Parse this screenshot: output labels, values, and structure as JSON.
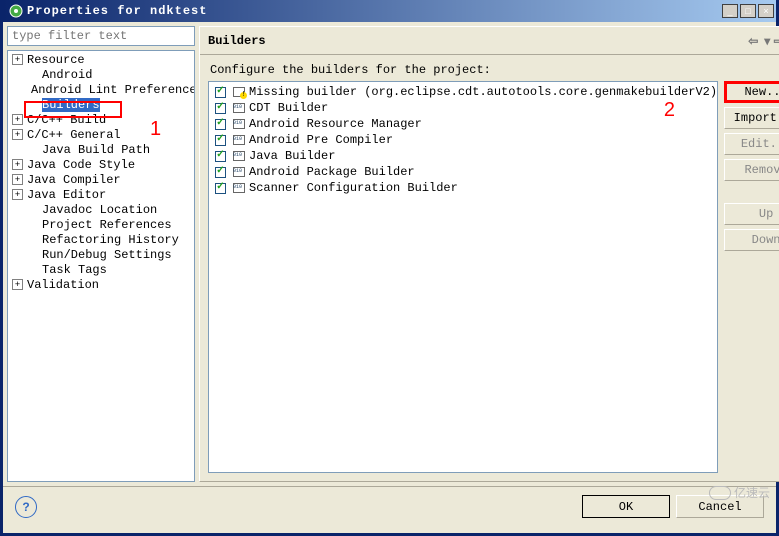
{
  "window": {
    "title": "Properties for ndktest"
  },
  "filter": {
    "placeholder": "type filter text"
  },
  "tree": [
    {
      "label": "Resource",
      "expand": "+",
      "depth": 1
    },
    {
      "label": "Android",
      "expand": "",
      "depth": 2
    },
    {
      "label": "Android Lint Preferences",
      "expand": "",
      "depth": 2
    },
    {
      "label": "Builders",
      "expand": "",
      "depth": 2,
      "selected": true
    },
    {
      "label": "C/C++ Build",
      "expand": "+",
      "depth": 1
    },
    {
      "label": "C/C++ General",
      "expand": "+",
      "depth": 1
    },
    {
      "label": "Java Build Path",
      "expand": "",
      "depth": 2
    },
    {
      "label": "Java Code Style",
      "expand": "+",
      "depth": 1
    },
    {
      "label": "Java Compiler",
      "expand": "+",
      "depth": 1
    },
    {
      "label": "Java Editor",
      "expand": "+",
      "depth": 1
    },
    {
      "label": "Javadoc Location",
      "expand": "",
      "depth": 2
    },
    {
      "label": "Project References",
      "expand": "",
      "depth": 2
    },
    {
      "label": "Refactoring History",
      "expand": "",
      "depth": 2
    },
    {
      "label": "Run/Debug Settings",
      "expand": "",
      "depth": 2
    },
    {
      "label": "Task Tags",
      "expand": "",
      "depth": 2
    },
    {
      "label": "Validation",
      "expand": "+",
      "depth": 1
    }
  ],
  "panel": {
    "title": "Builders",
    "subtitle": "Configure the builders for the project:",
    "items": [
      {
        "label": "Missing builder (org.eclipse.cdt.autotools.core.genmakebuilderV2)",
        "icon": "warn"
      },
      {
        "label": "CDT Builder",
        "icon": "bin"
      },
      {
        "label": "Android Resource Manager",
        "icon": "bin"
      },
      {
        "label": "Android Pre Compiler",
        "icon": "bin"
      },
      {
        "label": "Java Builder",
        "icon": "bin"
      },
      {
        "label": "Android Package Builder",
        "icon": "bin"
      },
      {
        "label": "Scanner Configuration Builder",
        "icon": "bin"
      }
    ],
    "buttons": {
      "new": "New...",
      "import": "Import...",
      "edit": "Edit...",
      "remove": "Remove",
      "up": "Up",
      "down": "Down"
    }
  },
  "footer": {
    "ok": "OK",
    "cancel": "Cancel"
  },
  "annotations": {
    "one": "1",
    "two": "2"
  },
  "watermark": "亿速云"
}
